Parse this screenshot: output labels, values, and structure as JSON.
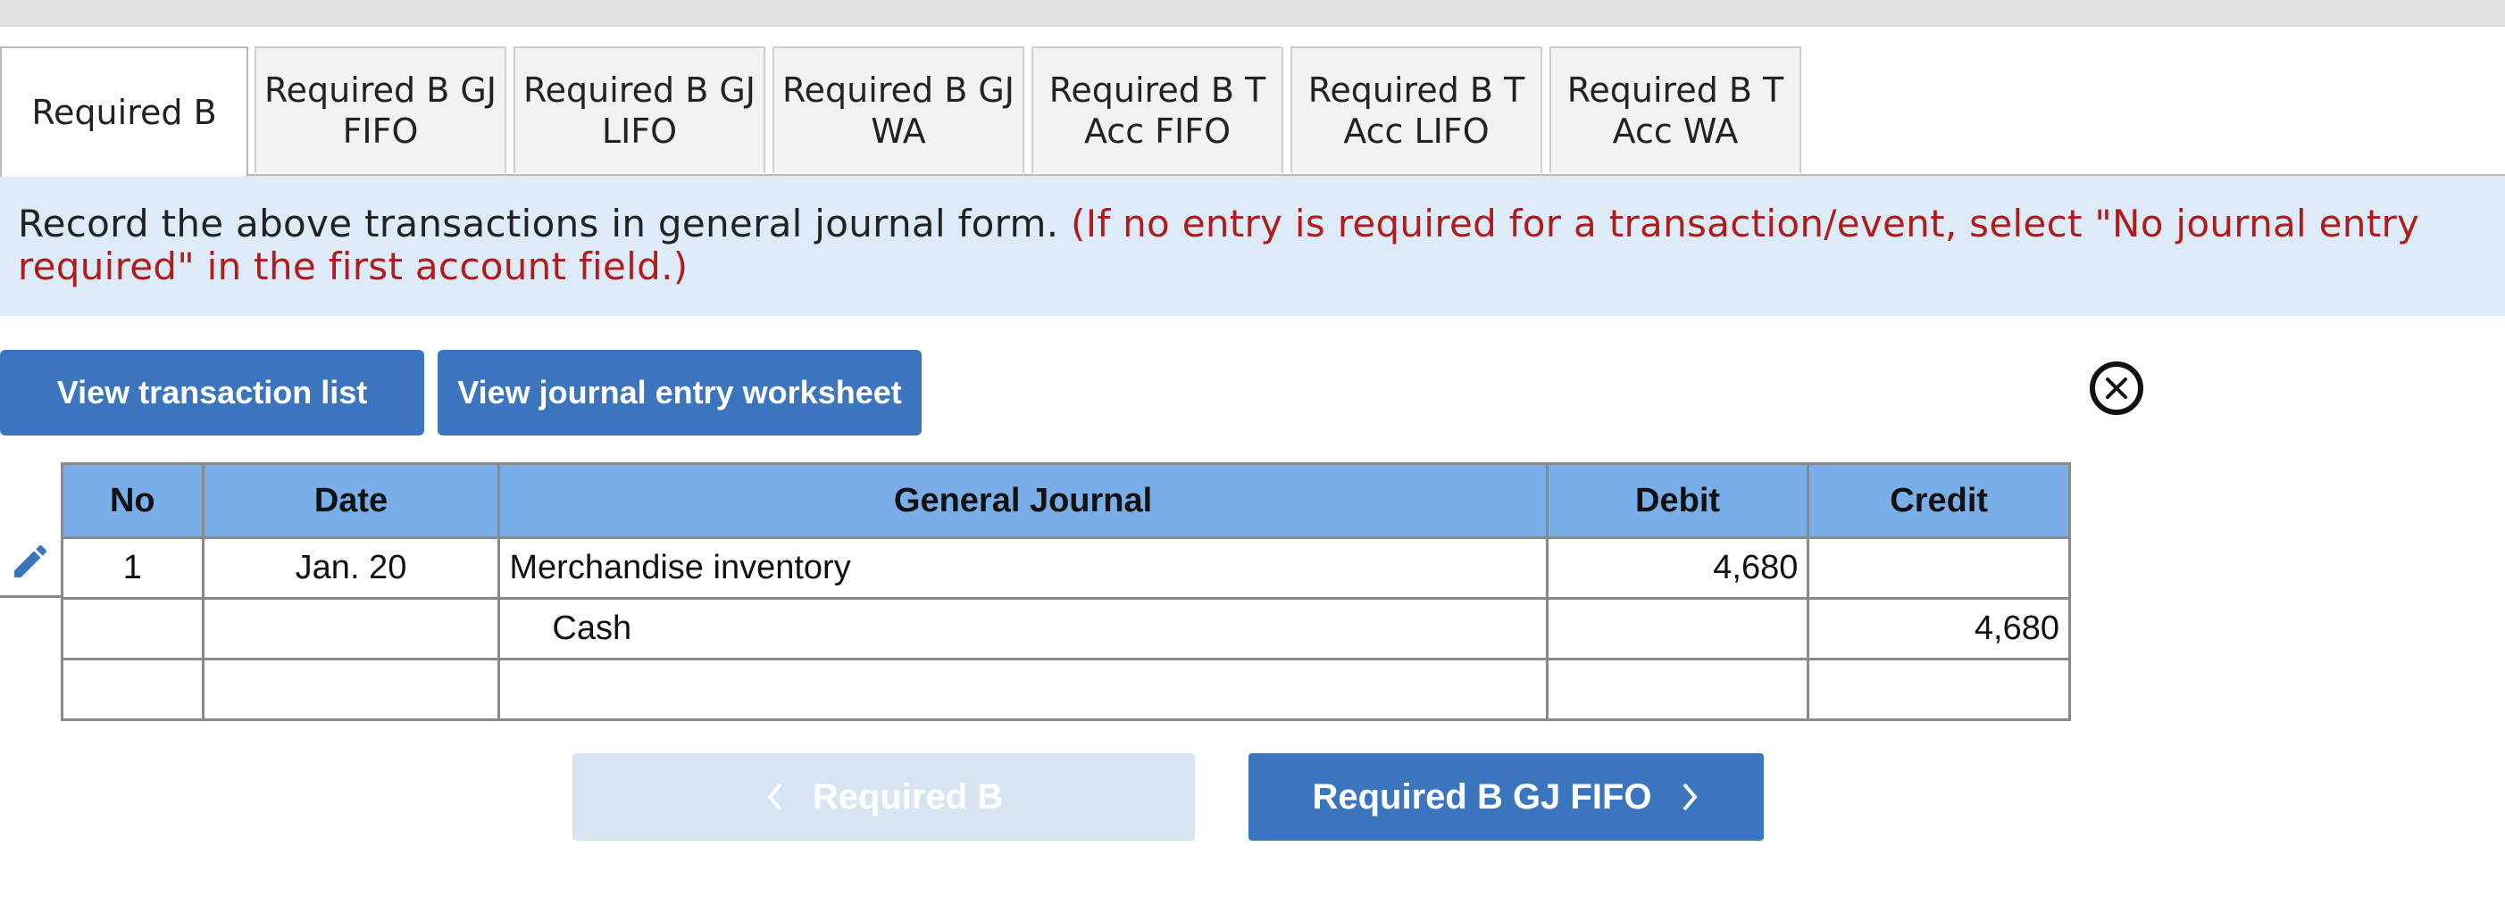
{
  "tabs": [
    {
      "label": "Required B",
      "active": true
    },
    {
      "label": "Required B GJ\nFIFO",
      "active": false
    },
    {
      "label": "Required B GJ\nLIFO",
      "active": false
    },
    {
      "label": "Required B GJ\nWA",
      "active": false
    },
    {
      "label": "Required B T\nAcc FIFO",
      "active": false
    },
    {
      "label": "Required B T\nAcc LIFO",
      "active": false
    },
    {
      "label": "Required B T\nAcc WA",
      "active": false
    }
  ],
  "instruction": {
    "text": "Record the above transactions in general journal form.",
    "note": "(If no entry is required for a transaction/event, select \"No journal entry required\" in the first account field.)"
  },
  "buttons": {
    "view_transactions": "View transaction list",
    "view_worksheet": "View journal entry worksheet"
  },
  "close_icon": "close-circle-icon",
  "table": {
    "headers": [
      "No",
      "Date",
      "General Journal",
      "Debit",
      "Credit"
    ],
    "rows": [
      {
        "no": "1",
        "date": "Jan. 20",
        "account": "Merchandise inventory",
        "debit": "4,680",
        "credit": ""
      },
      {
        "no": "",
        "date": "",
        "account": "Cash",
        "debit": "",
        "credit": "4,680"
      },
      {
        "no": "",
        "date": "",
        "account": "",
        "debit": "",
        "credit": ""
      }
    ]
  },
  "navigation": {
    "prev_label": "Required B",
    "next_label": "Required B GJ FIFO"
  },
  "colors": {
    "accent": "#3a75bd",
    "header": "#7aaee8",
    "banner": "#dcebf7",
    "note": "#b01c1c",
    "disabled": "#d7e4f2"
  }
}
